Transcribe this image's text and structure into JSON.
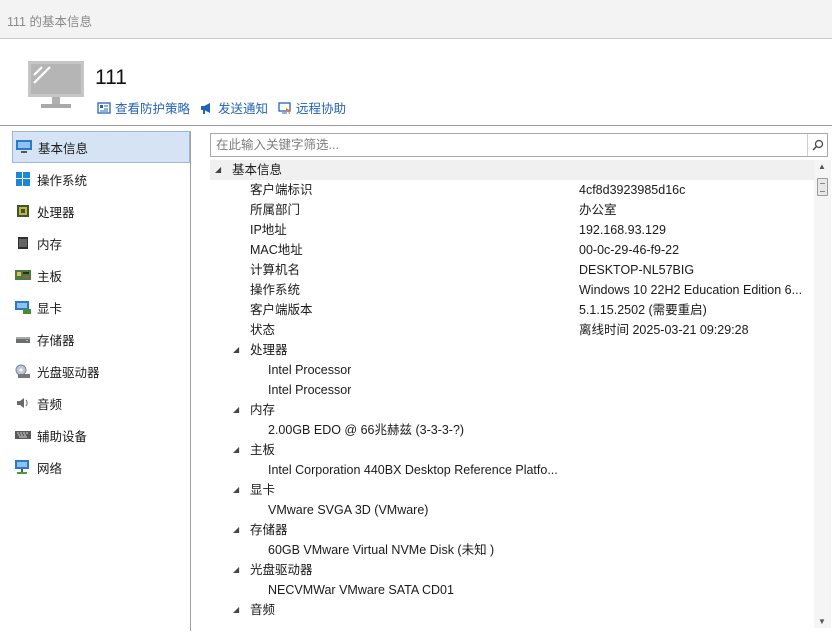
{
  "window": {
    "title": "111 的基本信息"
  },
  "header": {
    "machine_name": "111",
    "actions": [
      {
        "label": "查看防护策略",
        "icon": "policy-icon"
      },
      {
        "label": "发送通知",
        "icon": "megaphone-icon"
      },
      {
        "label": "远程协助",
        "icon": "remote-assist-icon"
      }
    ]
  },
  "sidebar": {
    "items": [
      {
        "label": "基本信息",
        "icon": "monitor-icon",
        "active": true
      },
      {
        "label": "操作系统",
        "icon": "windows-icon"
      },
      {
        "label": "处理器",
        "icon": "cpu-icon"
      },
      {
        "label": "内存",
        "icon": "memory-icon"
      },
      {
        "label": "主板",
        "icon": "motherboard-icon"
      },
      {
        "label": "显卡",
        "icon": "display-card-icon"
      },
      {
        "label": "存储器",
        "icon": "storage-icon"
      },
      {
        "label": "光盘驱动器",
        "icon": "optical-drive-icon"
      },
      {
        "label": "音频",
        "icon": "audio-icon"
      },
      {
        "label": "辅助设备",
        "icon": "keyboard-icon"
      },
      {
        "label": "网络",
        "icon": "network-icon"
      }
    ]
  },
  "search": {
    "placeholder": "在此输入关键字筛选..."
  },
  "tree": {
    "root_label": "基本信息",
    "basic": [
      {
        "key": "客户端标识",
        "value": "4cf8d3923985d16c"
      },
      {
        "key": "所属部门",
        "value": "办公室"
      },
      {
        "key": "IP地址",
        "value": "192.168.93.129"
      },
      {
        "key": "MAC地址",
        "value": "00-0c-29-46-f9-22"
      },
      {
        "key": "计算机名",
        "value": "DESKTOP-NL57BIG"
      },
      {
        "key": "操作系统",
        "value": "Windows 10 22H2 Education Edition 6..."
      },
      {
        "key": "客户端版本",
        "value": "5.1.15.2502 (需要重启)"
      },
      {
        "key": "状态",
        "value": "离线时间 2025-03-21 09:29:28"
      }
    ],
    "groups": [
      {
        "label": "处理器",
        "items": [
          "Intel Processor",
          "Intel Processor"
        ]
      },
      {
        "label": "内存",
        "items": [
          "2.00GB EDO @ 66兆赫兹 (3-3-3-?)"
        ]
      },
      {
        "label": "主板",
        "items": [
          "Intel Corporation 440BX Desktop Reference Platfo..."
        ]
      },
      {
        "label": "显卡",
        "items": [
          "VMware SVGA 3D (VMware)"
        ]
      },
      {
        "label": "存储器",
        "items": [
          "60GB VMware Virtual NVMe Disk (未知 )"
        ]
      },
      {
        "label": "光盘驱动器",
        "items": [
          "NECVMWar VMware SATA CD01"
        ]
      },
      {
        "label": "音频",
        "items": []
      }
    ]
  },
  "colors": {
    "link": "#2463b8",
    "selection": "#d5e3f4",
    "selection_border": "#9ab7da"
  }
}
